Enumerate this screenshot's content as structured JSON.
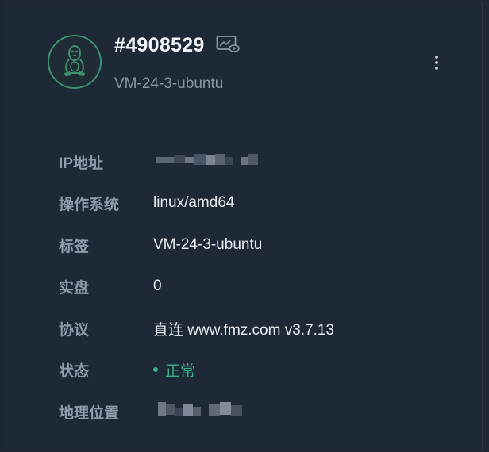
{
  "header": {
    "vm_id": "#4908529",
    "hostname": "VM-24-3-ubuntu",
    "avatar_icon": "linux-tux-icon",
    "monitor_icon": "monitor-view-icon",
    "more_icon": "more-vertical-icon"
  },
  "details": [
    {
      "key": "ip",
      "label": "IP地址",
      "value": ""
    },
    {
      "key": "os",
      "label": "操作系统",
      "value": "linux/amd64"
    },
    {
      "key": "tag",
      "label": "标签",
      "value": "VM-24-3-ubuntu"
    },
    {
      "key": "live",
      "label": "实盘",
      "value": "0"
    },
    {
      "key": "protocol",
      "label": "协议",
      "value": "直连 www.fmz.com v3.7.13"
    },
    {
      "key": "status",
      "label": "状态",
      "value": "正常"
    },
    {
      "key": "location",
      "label": "地理位置",
      "value": ""
    }
  ],
  "colors": {
    "background": "#1e2938",
    "accent": "#3fae86",
    "avatar_border": "#3c8f6f",
    "label": "#8f9aaa",
    "value": "#e8ecf1"
  }
}
